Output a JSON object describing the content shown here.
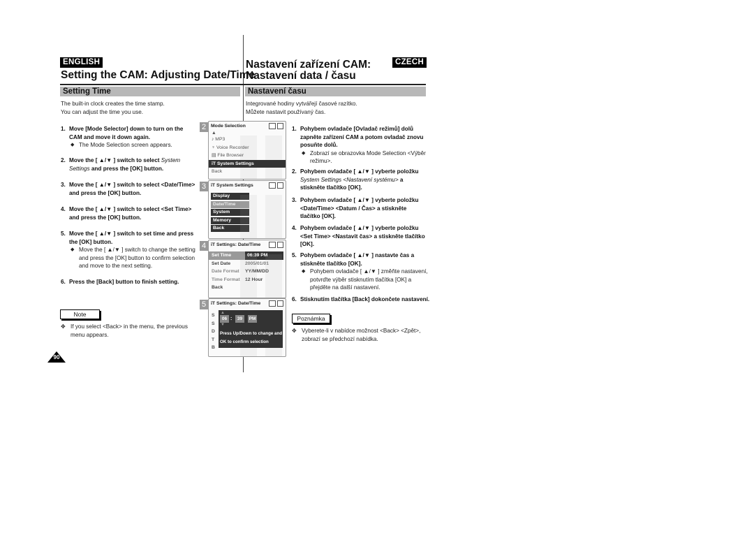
{
  "left": {
    "lang_badge": "ENGLISH",
    "title": "Setting the CAM: Adjusting Date/Time",
    "section": "Setting Time",
    "intro": [
      "The built-in clock creates the time stamp.",
      "You can adjust the time you use."
    ],
    "steps": [
      {
        "num": "1.",
        "text": "Move [Mode Selector] down to turn on the CAM and move it down again.",
        "sub": "The Mode Selection screen appears."
      },
      {
        "num": "2.",
        "text_a": "Move the [ ▲/▼ ] switch to select ",
        "text_italic": "System Settings",
        "text_b": " and press the [OK] button."
      },
      {
        "num": "3.",
        "text": "Move the [ ▲/▼ ] switch to select <Date/Time> and press the [OK] button."
      },
      {
        "num": "4.",
        "text": "Move the [ ▲/▼ ] switch to select <Set Time> and press the [OK] button."
      },
      {
        "num": "5.",
        "text": "Move the [ ▲/▼ ] switch to set time and press the [OK] button.",
        "sub": "Move the [ ▲/▼ ] switch to change the setting and press the [OK] button to confirm selection and move to the next setting."
      },
      {
        "num": "6.",
        "text": "Press the [Back] button to finish setting."
      }
    ],
    "note_label": "Note",
    "note_text": "If you select <Back> in the menu, the previous menu appears."
  },
  "right": {
    "lang_badge": "CZECH",
    "title_line1": "Nastavení zařízení CAM:",
    "title_line2": "Nastavení data / času",
    "section": "Nastavení času",
    "intro": [
      "Integrované hodiny vytvářejí časové razítko.",
      "Můžete nastavit používaný čas."
    ],
    "steps": [
      {
        "num": "1.",
        "text": "Pohybem ovladače [Ovladač režimů] dolů zapněte zařízení CAM a potom ovladač znovu posuňte dolů.",
        "sub": "Zobrazí se obrazovka Mode Selection <Výběr režimu>."
      },
      {
        "num": "2.",
        "text_a": "Pohybem ovladače [ ▲/▼ ] vyberte položku ",
        "text_italic": "System Settings <Nastavení systému>",
        "text_b": " a stiskněte tlačítko [OK]."
      },
      {
        "num": "3.",
        "text": "Pohybem ovladače [ ▲/▼ ] vyberte položku <Date/Time> <Datum / Čas> a stiskněte tlačítko [OK]."
      },
      {
        "num": "4.",
        "text": "Pohybem ovladače [ ▲/▼ ] vyberte položku <Set Time> <Nastavit čas> a stiskněte tlačítko [OK]."
      },
      {
        "num": "5.",
        "text": "Pohybem ovladače [ ▲/▼ ] nastavte čas a stiskněte tlačítko [OK].",
        "sub": "Pohybem ovladače [ ▲/▼ ] změňte nastavení, potvrďte výběr stisknutím tlačítka [OK] a přejděte na další nastavení."
      },
      {
        "num": "6.",
        "text": "Stisknutím tlačítka [Back] dokončete nastavení."
      }
    ],
    "note_label": "Poznámka",
    "note_text": "Vyberete-li v nabídce možnost <Back> <Zpět>, zobrazí se předchozí nabídka."
  },
  "bullet_diamond": "◆",
  "bullet_cross": "✥",
  "screens": [
    {
      "num": "2",
      "title": "Mode Selection",
      "items": [
        {
          "icon": "music-note-icon",
          "glyph": "♪",
          "label": "MP3"
        },
        {
          "icon": "microphone-icon",
          "glyph": "🎙",
          "label": "Voice Recorder"
        },
        {
          "icon": "file-icon",
          "glyph": "▤",
          "label": "File Browser"
        },
        {
          "icon": "settings-icon",
          "glyph": "⫶",
          "label": "System Settings",
          "selected": true
        },
        {
          "label": "Back"
        }
      ]
    },
    {
      "num": "3",
      "title": "System Settings",
      "items": [
        {
          "label": "Display"
        },
        {
          "label": "Date/Time",
          "selected": true
        },
        {
          "label": "System"
        },
        {
          "label": "Memory"
        },
        {
          "label": "Back"
        }
      ]
    },
    {
      "num": "4",
      "title": "Settings: Date/Time",
      "rows": [
        {
          "key": "Set Time",
          "value": "06:39 PM",
          "selected": true
        },
        {
          "key": "Set Date",
          "value": "2005/01/01"
        },
        {
          "key": "Date Format",
          "value": "YY/MM/DD"
        },
        {
          "key": "Time Format",
          "value": "12 Hour"
        },
        {
          "key": "Back",
          "value": ""
        }
      ]
    },
    {
      "num": "5",
      "title": "Settings: Date/Time",
      "popup": {
        "hour": "06",
        "sep": ":",
        "minute": "39",
        "ampm": "PM",
        "msg1": "Press Up/Down to change and",
        "msg2": "OK to confirm selection"
      }
    }
  ],
  "page_number": "90"
}
